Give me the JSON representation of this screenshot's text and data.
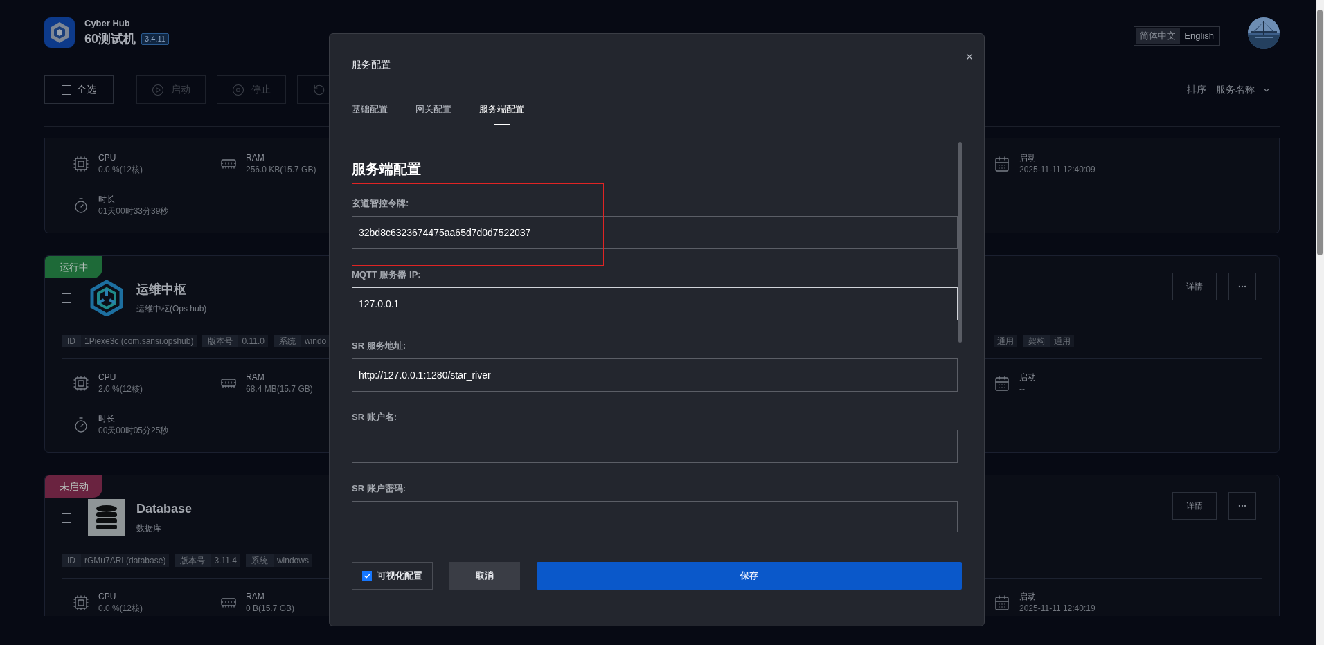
{
  "app": {
    "name": "Cyber Hub",
    "machine": "60测试机",
    "version": "3.4.11"
  },
  "languages": [
    {
      "label": "简体中文",
      "selected": true
    },
    {
      "label": "English",
      "selected": false
    }
  ],
  "toolbar": {
    "select_all": {
      "label": "全选",
      "checked": false
    },
    "actions": [
      {
        "kind": "start",
        "label": "启动",
        "disabled": true
      },
      {
        "kind": "stop",
        "label": "停止",
        "disabled": true
      },
      {
        "kind": "restart",
        "disabled": true
      }
    ],
    "sort": {
      "label": "排序",
      "value": "服务名称"
    }
  },
  "services": [
    {
      "metrics": [
        {
          "kind": "cpu",
          "label": "CPU",
          "value": "0.0 %(12核)"
        },
        {
          "kind": "ram",
          "label": "RAM",
          "value": "256.0 KB(15.7 GB)"
        },
        {
          "kind": "started",
          "label": "启动",
          "value": "2025-11-11 12:40:09"
        },
        {
          "kind": "duration",
          "label": "时长",
          "value": "01天00时33分39秒"
        }
      ]
    },
    {
      "status": {
        "kind": "running",
        "label": "运行中"
      },
      "checked": false,
      "kind": "ops",
      "title": "运维中枢",
      "subtitle": "运维中枢(Ops hub)",
      "details": "详情",
      "tags_left": [
        {
          "label": "ID",
          "value": "1Piexe3c (com.sansi.opshub)"
        },
        {
          "label": "版本号",
          "value": "0.11.0"
        },
        {
          "label": "系统",
          "value": "windo"
        }
      ],
      "tags_right": [
        {
          "value": "通用"
        },
        {
          "label": "架构",
          "value": "通用"
        }
      ],
      "metrics": [
        {
          "kind": "cpu",
          "label": "CPU",
          "value": "2.0 %(12核)"
        },
        {
          "kind": "ram",
          "label": "RAM",
          "value": "68.4 MB(15.7 GB)"
        },
        {
          "kind": "started",
          "label": "启动",
          "value": "--"
        },
        {
          "kind": "duration",
          "label": "时长",
          "value": "00天00时05分25秒"
        }
      ]
    },
    {
      "status": {
        "kind": "stopped",
        "label": "未启动"
      },
      "checked": false,
      "kind": "database",
      "title": "Database",
      "subtitle": "数据库",
      "details": "详情",
      "tags_left": [
        {
          "label": "ID",
          "value": "rGMu7ARI (database)"
        },
        {
          "label": "版本号",
          "value": "3.11.4"
        },
        {
          "label": "系统",
          "value": "windows"
        }
      ],
      "metrics": [
        {
          "kind": "cpu",
          "label": "CPU",
          "value": "0.0 %(12核)"
        },
        {
          "kind": "ram",
          "label": "RAM",
          "value": "0 B(15.7 GB)"
        },
        {
          "kind": "started",
          "label": "启动",
          "value": "2025-11-11 12:40:19"
        }
      ]
    }
  ],
  "dialog": {
    "title": "服务配置",
    "tabs": [
      {
        "label": "基础配置",
        "selected": false
      },
      {
        "label": "网关配置",
        "selected": false
      },
      {
        "label": "服务端配置",
        "selected": true
      }
    ],
    "section_title": "服务端配置",
    "fields": [
      {
        "label": "玄道智控令牌:",
        "value": "32bd8c6323674475aa65d7d0d7522037",
        "focused": false,
        "annotated": true
      },
      {
        "label": "MQTT 服务器 IP:",
        "value": "127.0.0.1",
        "focused": true,
        "annotated": false
      },
      {
        "label": "SR 服务地址:",
        "value": "http://127.0.0.1:1280/star_river",
        "focused": false,
        "annotated": false
      },
      {
        "label": "SR 账户名:",
        "focused": false,
        "annotated": false
      },
      {
        "label": "SR 账户密码:",
        "focused": false,
        "annotated": false
      }
    ],
    "visual_config": {
      "label": "可视化配置",
      "checked": true
    },
    "cancel": "取消",
    "save": "保存"
  }
}
